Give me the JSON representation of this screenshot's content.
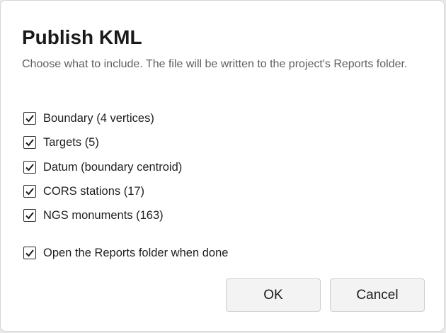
{
  "dialog": {
    "title": "Publish KML",
    "subtitle": "Choose what to include. The file will be written to the project's Reports folder.",
    "options": [
      {
        "label": "Boundary (4 vertices)",
        "checked": true
      },
      {
        "label": "Targets (5)",
        "checked": true
      },
      {
        "label": "Datum (boundary centroid)",
        "checked": true
      },
      {
        "label": "CORS stations (17)",
        "checked": true
      },
      {
        "label": "NGS monuments (163)",
        "checked": true
      }
    ],
    "open_folder": {
      "label": "Open the Reports folder when done",
      "checked": true
    },
    "ok_label": "OK",
    "cancel_label": "Cancel"
  }
}
